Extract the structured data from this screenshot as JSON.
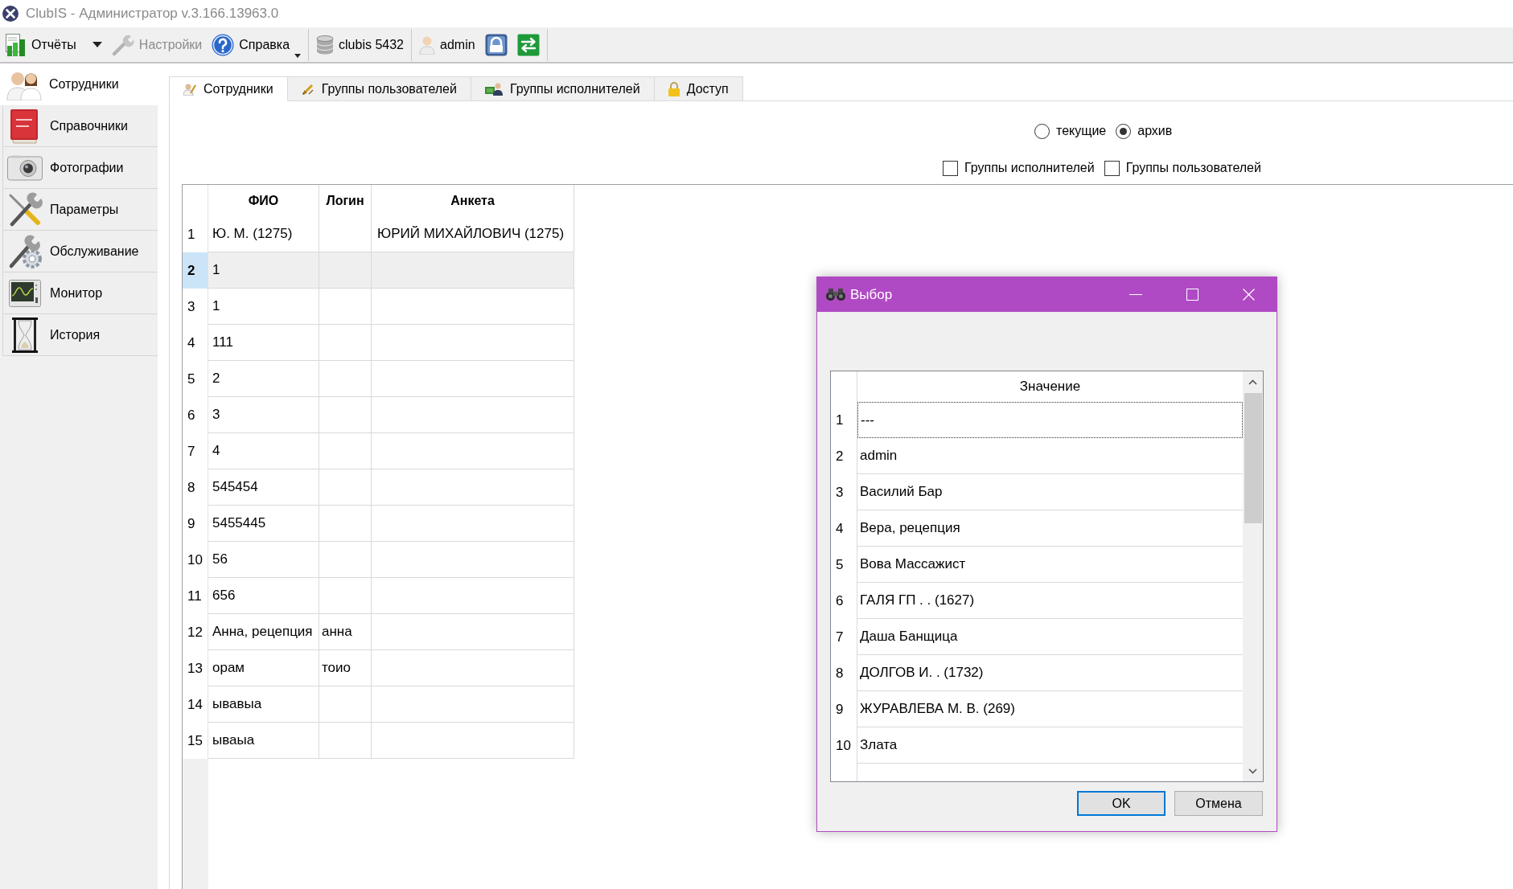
{
  "window": {
    "title": "ClubIS - Администратор v.3.166.13963.0"
  },
  "toolbar": {
    "groups": [
      [
        {
          "kind": "reports",
          "label": "Отчёты",
          "disabled": false
        },
        {
          "kind": "settings",
          "label": "Настройки",
          "disabled": true
        },
        {
          "kind": "help",
          "label": "Справка",
          "disabled": false
        }
      ],
      [
        {
          "kind": "database",
          "label": "clubis 5432",
          "disabled": false
        }
      ],
      [
        {
          "kind": "user",
          "label": "admin",
          "disabled": false
        },
        {
          "kind": "lock",
          "disabled": false
        },
        {
          "kind": "exit",
          "disabled": false
        }
      ]
    ]
  },
  "sidebar": {
    "items": [
      {
        "label": "Сотрудники",
        "selected": true
      },
      {
        "label": "Справочники",
        "selected": false
      },
      {
        "label": "Фотографии",
        "selected": false
      },
      {
        "label": "Параметры",
        "selected": false
      },
      {
        "label": "Обслуживание",
        "selected": false
      },
      {
        "label": "Монитор",
        "selected": false
      },
      {
        "label": "История",
        "selected": false
      }
    ]
  },
  "tabs": [
    {
      "label": "Сотрудники",
      "selected": true
    },
    {
      "label": "Группы пользователей",
      "selected": false
    },
    {
      "label": "Группы исполнителей",
      "selected": false
    },
    {
      "label": "Доступ",
      "selected": false
    }
  ],
  "filters": {
    "radios": [
      {
        "label": "текущие",
        "selected": false
      },
      {
        "label": "архив",
        "selected": true
      }
    ],
    "checkboxes": [
      {
        "label": "Группы исполнителей",
        "checked": false
      },
      {
        "label": "Группы пользователей",
        "checked": false
      }
    ]
  },
  "table": {
    "columns": [
      "ФИО",
      "Логин",
      "Анкета"
    ],
    "rows": [
      {
        "number": "1",
        "full_name": "Ю. М. (1275)",
        "profile": "ЮРИЙ МИХАЙЛОВИЧ (1275)",
        "selected": false
      },
      {
        "number": "2",
        "full_name": "1",
        "selected": true
      },
      {
        "number": "3",
        "full_name": "1",
        "selected": false
      },
      {
        "number": "4",
        "full_name": "111",
        "selected": false
      },
      {
        "number": "5",
        "full_name": "2",
        "selected": false
      },
      {
        "number": "6",
        "full_name": "3",
        "selected": false
      },
      {
        "number": "7",
        "full_name": "4",
        "selected": false
      },
      {
        "number": "8",
        "full_name": "545454",
        "selected": false
      },
      {
        "number": "9",
        "full_name": "5455445",
        "selected": false
      },
      {
        "number": "10",
        "full_name": "56",
        "selected": false
      },
      {
        "number": "11",
        "full_name": "656",
        "selected": false
      },
      {
        "number": "12",
        "full_name": "Анна, рецепция",
        "login": "анна",
        "selected": false
      },
      {
        "number": "13",
        "full_name": "орам",
        "login": "тоио",
        "selected": false
      },
      {
        "number": "14",
        "full_name": "ывавыа",
        "selected": false
      },
      {
        "number": "15",
        "full_name": "ываыа",
        "selected": false
      }
    ]
  },
  "dialog": {
    "title": "Выбор",
    "column": "Значение",
    "rows": [
      {
        "number": "1",
        "value": "---",
        "focused": true
      },
      {
        "number": "2",
        "value": "admin",
        "focused": false
      },
      {
        "number": "3",
        "value": "Василий Бар",
        "focused": false
      },
      {
        "number": "4",
        "value": "Вера, рецепция",
        "focused": false
      },
      {
        "number": "5",
        "value": "Вова Массажист",
        "focused": false
      },
      {
        "number": "6",
        "value": "ГАЛЯ ГП . . (1627)",
        "focused": false
      },
      {
        "number": "7",
        "value": "Даша Банщица",
        "focused": false
      },
      {
        "number": "8",
        "value": "ДОЛГОВ И. . (1732)",
        "focused": false
      },
      {
        "number": "9",
        "value": "ЖУРАВЛЕВА М. В. (269)",
        "focused": false
      },
      {
        "number": "10",
        "value": "Злата",
        "focused": false
      }
    ],
    "buttons": [
      {
        "label": "OK",
        "default": true
      },
      {
        "label": "Отмена",
        "default": false
      }
    ]
  }
}
